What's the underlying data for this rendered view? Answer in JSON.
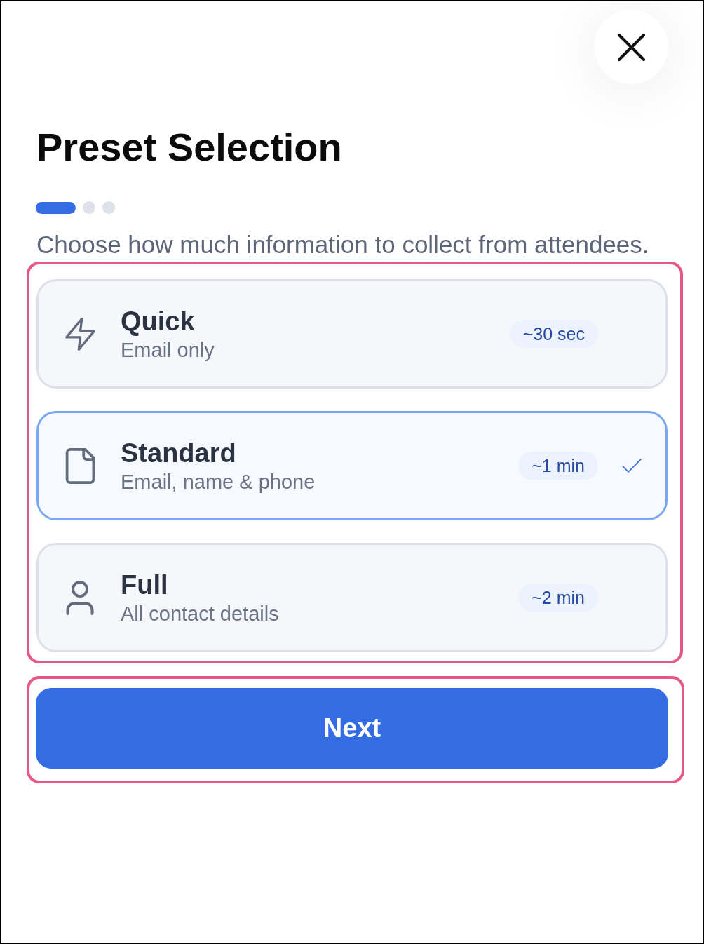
{
  "header": {
    "title": "Preset Selection"
  },
  "steps": [
    {
      "selected": true
    },
    {
      "selected": false
    },
    {
      "selected": false
    }
  ],
  "description": "Choose how much information to collect from attendees.",
  "presets": [
    {
      "title": "Quick",
      "subtitle": "Email only",
      "duration": "~30 sec",
      "selected": false
    },
    {
      "title": "Standard",
      "subtitle": "Email, name & phone",
      "duration": "~1 min",
      "selected": true
    },
    {
      "title": "Full",
      "subtitle": "All contact details",
      "duration": "~2 min",
      "selected": false
    }
  ],
  "next_button": {
    "label": "Next"
  }
}
